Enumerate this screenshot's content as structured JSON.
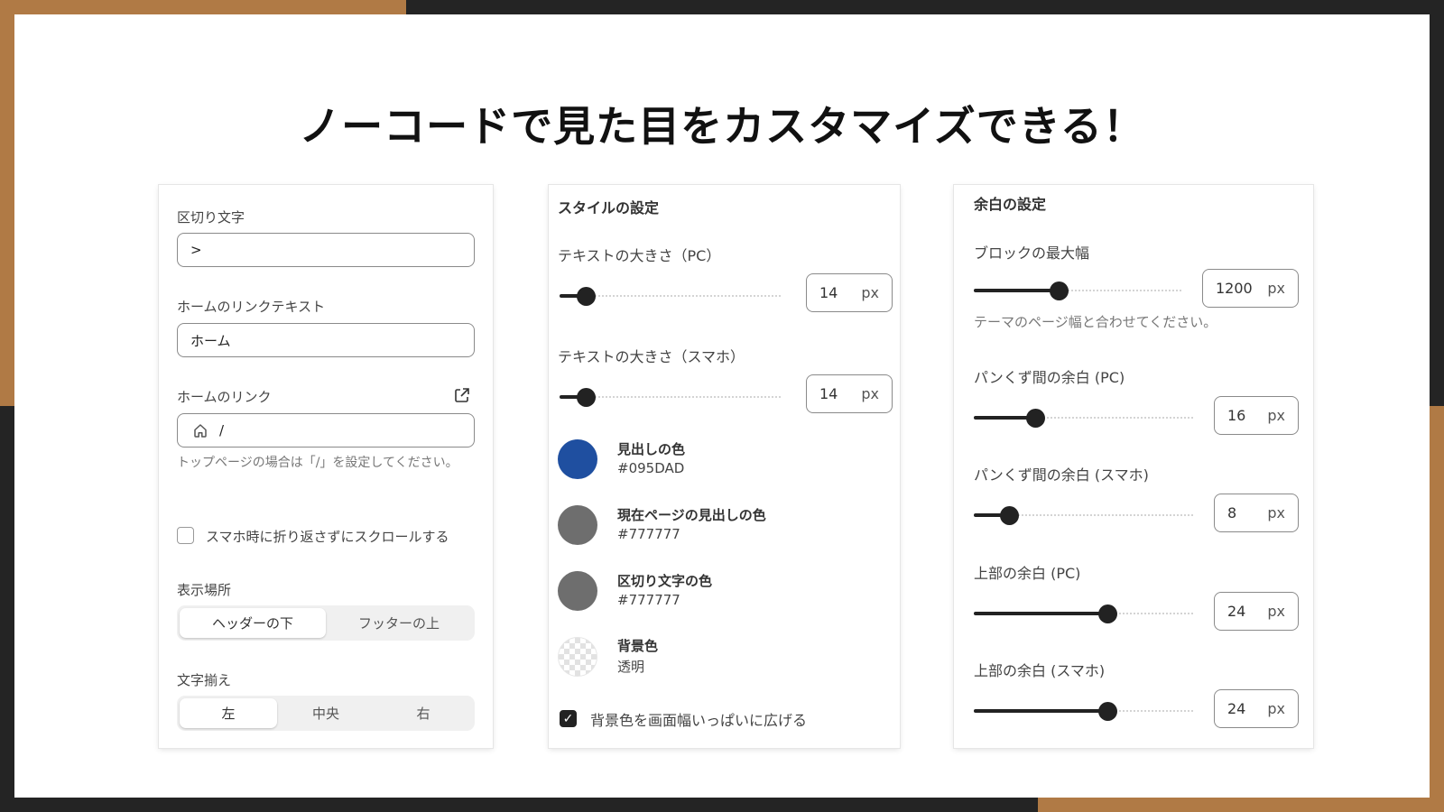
{
  "headline": "ノーコードで見た目をカスタマイズできる！",
  "colors": {
    "accent": "#b07a45",
    "dark": "#242424",
    "heading_swatch": "#095DAD",
    "gray_swatch": "#777777"
  },
  "panel1": {
    "separator_label": "区切り文字",
    "separator_value": ">",
    "home_text_label": "ホームのリンクテキスト",
    "home_text_value": "ホーム",
    "home_link_label": "ホームのリンク",
    "home_link_value": "/",
    "home_link_hint": "トップページの場合は「/」を設定してください。",
    "no_wrap_label": "スマホ時に折り返さずにスクロールする",
    "no_wrap_checked": false,
    "position_label": "表示場所",
    "position_options": [
      "ヘッダーの下",
      "フッターの上"
    ],
    "position_selected": "ヘッダーの下",
    "align_label": "文字揃え",
    "align_options": [
      "左",
      "中央",
      "右"
    ],
    "align_selected": "左"
  },
  "panel2": {
    "title": "スタイルの設定",
    "text_size_pc_label": "テキストの大きさ（PC）",
    "text_size_pc_value": "14",
    "text_size_pc_level": 0.12,
    "text_size_sp_label": "テキストの大きさ（スマホ）",
    "text_size_sp_value": "14",
    "text_size_sp_level": 0.12,
    "unit": "px",
    "colors": [
      {
        "name": "見出しの色",
        "value": "#095DAD",
        "swatch": "#1f4fa0"
      },
      {
        "name": "現在ページの見出しの色",
        "value": "#777777",
        "swatch": "#6e6e6e"
      },
      {
        "name": "区切り文字の色",
        "value": "#777777",
        "swatch": "#6e6e6e"
      },
      {
        "name": "背景色",
        "value": "透明",
        "swatch": "transparent"
      }
    ],
    "full_width_label": "背景色を画面幅いっぱいに広げる",
    "full_width_checked": true
  },
  "panel3": {
    "title": "余白の設定",
    "max_width_label": "ブロックの最大幅",
    "max_width_value": "1200",
    "max_width_level": 0.41,
    "max_width_hint": "テーマのページ幅と合わせてください。",
    "gap_pc_label": "パンくず間の余白 (PC)",
    "gap_pc_value": "16",
    "gap_pc_level": 0.28,
    "gap_sp_label": "パンくず間の余白 (スマホ)",
    "gap_sp_value": "8",
    "gap_sp_level": 0.16,
    "top_pc_label": "上部の余白 (PC)",
    "top_pc_value": "24",
    "top_pc_level": 0.61,
    "top_sp_label": "上部の余白 (スマホ)",
    "top_sp_value": "24",
    "top_sp_level": 0.61,
    "unit": "px"
  }
}
